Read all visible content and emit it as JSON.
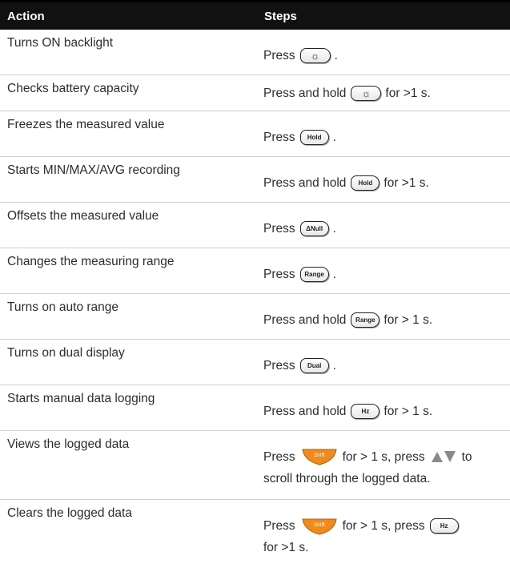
{
  "header": {
    "action": "Action",
    "steps": "Steps"
  },
  "rows": [
    {
      "action": "Turns ON backlight",
      "pre": "Press",
      "key": "☼",
      "post": "."
    },
    {
      "action": "Checks battery capacity",
      "pre": "Press and hold",
      "key": "☼",
      "post": "for >1 s."
    },
    {
      "action": "Freezes the measured value",
      "pre": "Press",
      "key": "Hold",
      "post": "."
    },
    {
      "action": "Starts MIN/MAX/AVG recording",
      "pre": "Press and hold",
      "key": "Hold",
      "post": "for >1 s."
    },
    {
      "action": "Offsets the measured value",
      "pre": "Press",
      "key": "ΔNull",
      "post": "."
    },
    {
      "action": "Changes the measuring range",
      "pre": "Press",
      "key": "Range",
      "post": "."
    },
    {
      "action": "Turns on auto range",
      "pre": "Press and hold",
      "key": "Range",
      "post": "for > 1 s."
    },
    {
      "action": "Turns on dual display",
      "pre": "Press",
      "key": "Dual",
      "post": "."
    },
    {
      "action": "Starts manual data logging",
      "pre": "Press and hold",
      "key": "Hz",
      "post": "for > 1 s."
    },
    {
      "action": "Views the logged data",
      "pre": "Press",
      "key": "Shift",
      "mid": "for > 1 s, press",
      "post1": "to",
      "post2": "scroll through the logged data."
    },
    {
      "action": "Clears the logged data",
      "pre": "Press",
      "key": "Shift",
      "mid": "for > 1 s, press",
      "key2": "Hz",
      "post": "for >1 s."
    }
  ],
  "colors": {
    "header_bg": "#111111",
    "shift_key": "#f08a1c",
    "arrow_key": "#8a8a8a"
  },
  "icons": {
    "backlight_key": "sun-icon",
    "navigation_keys": "up-down-arrow-icon"
  }
}
